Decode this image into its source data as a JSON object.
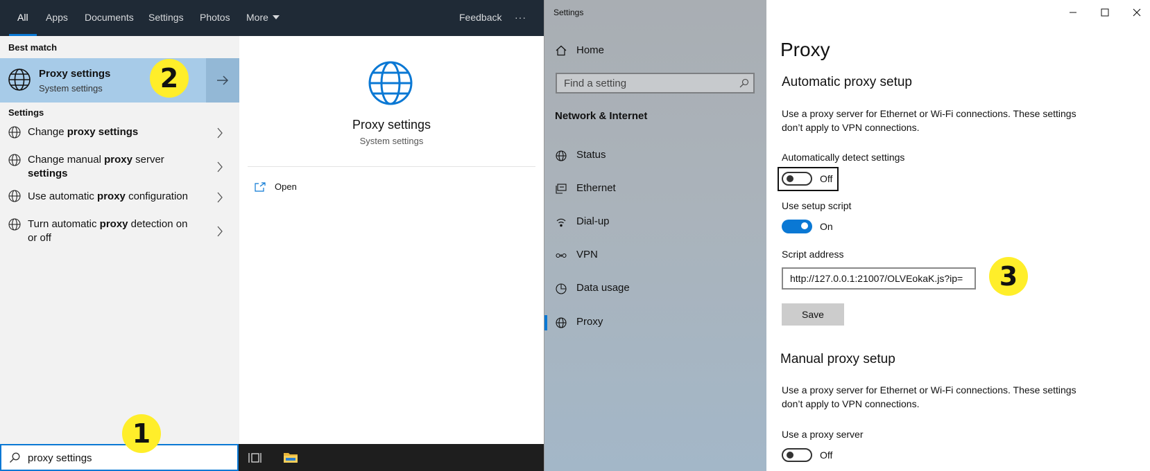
{
  "search": {
    "tabs": [
      {
        "label": "All",
        "active": true
      },
      {
        "label": "Apps"
      },
      {
        "label": "Documents"
      },
      {
        "label": "Settings"
      },
      {
        "label": "Photos"
      },
      {
        "label": "More"
      }
    ],
    "feedback_label": "Feedback",
    "more_options_label": "···",
    "best_match_header": "Best match",
    "best_match": {
      "title": "Proxy settings",
      "subtitle": "System settings"
    },
    "settings_header": "Settings",
    "results": [
      {
        "pre": "Change ",
        "bold": "proxy settings",
        "post": ""
      },
      {
        "pre": "Change manual ",
        "bold": "proxy",
        "post": " server",
        "line2": "settings"
      },
      {
        "pre": "Use automatic ",
        "bold": "proxy",
        "post": " configuration"
      },
      {
        "pre": "Turn automatic ",
        "bold": "proxy",
        "post": " detection on",
        "line2": "or off"
      }
    ],
    "preview": {
      "title": "Proxy settings",
      "subtitle": "System settings",
      "open_label": "Open"
    },
    "query": "proxy settings"
  },
  "settings": {
    "window_title": "Settings",
    "nav": {
      "home": "Home",
      "find_placeholder": "Find a setting",
      "section": "Network & Internet",
      "items": [
        "Status",
        "Ethernet",
        "Dial-up",
        "VPN",
        "Data usage",
        "Proxy"
      ],
      "selected": "Proxy"
    },
    "page_title": "Proxy",
    "auto": {
      "heading": "Automatic proxy setup",
      "desc_line1": "Use a proxy server for Ethernet or Wi-Fi connections. These settings",
      "desc_line2": "don’t apply to VPN connections.",
      "detect_label": "Automatically detect settings",
      "detect_state": "Off",
      "script_label": "Use setup script",
      "script_state": "On",
      "address_label": "Script address",
      "address_value": "http://127.0.0.1:21007/OLVEokaK.js?ip=",
      "save_label": "Save"
    },
    "manual": {
      "heading": "Manual proxy setup",
      "desc_line1": "Use a proxy server for Ethernet or Wi-Fi connections. These settings",
      "desc_line2": "don’t apply to VPN connections.",
      "use_label": "Use a proxy server",
      "use_state": "Off"
    }
  },
  "annotations": {
    "step1": "1",
    "step2": "2",
    "step3": "3"
  },
  "colors": {
    "accent": "#0a78d4",
    "highlight": "#a7cbe8",
    "badge": "#ffee2a",
    "tabbar": "#1f2a36"
  }
}
